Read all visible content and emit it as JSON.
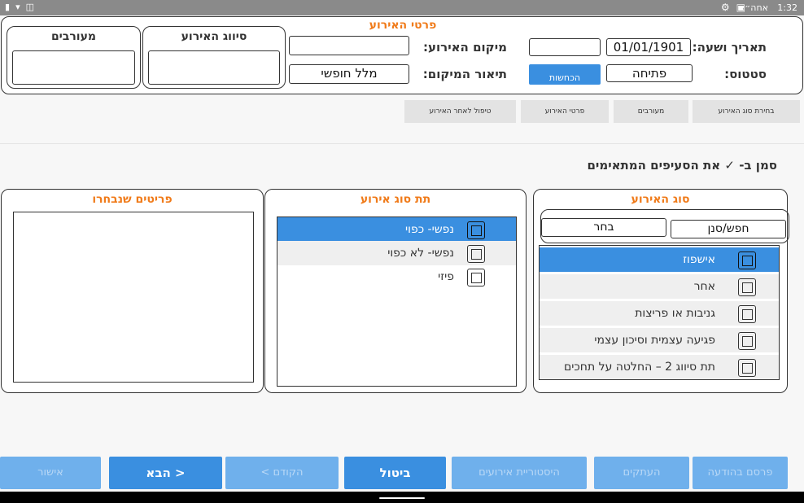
{
  "status_bar": {
    "time": "1:32",
    "carrier": "אחה״צ",
    "icons": [
      "gear-icon",
      "image-icon",
      "battery-icon",
      "wifi-icon",
      "vibrate-icon"
    ]
  },
  "header": {
    "title": "פרטי האירוע",
    "date_label": "תאריך ושעה:",
    "date_value": "01/01/1901",
    "time_value": "",
    "status_label": "סטטוס:",
    "status_value": "פתיחה",
    "status_button_label": "הכחשות",
    "location_label": "מיקום האירוע:",
    "location_value": "",
    "location_desc_label": "תיאור המיקום:",
    "location_desc_value": "מלל חופשי",
    "classification_title": "סיווג האירוע",
    "involved_title": "מעורבים"
  },
  "tabs": [
    {
      "label": "בחירת סוג האירוע"
    },
    {
      "label": "מעורבים"
    },
    {
      "label": "פרטי האירוע"
    },
    {
      "label": "טיפול לאחר האירוע"
    }
  ],
  "instruction": "סמן ב- ✓ את הסעיפים המתאימים",
  "event_type_panel": {
    "title": "סוג האירוע",
    "search_value": "חפש/סנן",
    "choose_value": "בחר",
    "items": [
      {
        "label": "אישפוז",
        "selected": true
      },
      {
        "label": "אחר",
        "selected": false
      },
      {
        "label": "גניבות או פריצות",
        "selected": false
      },
      {
        "label": "פגיעה עצמית וסיכון עצמי",
        "selected": false
      },
      {
        "label": "תת סיווג 2 – החלטה על תחכים",
        "selected": false
      }
    ]
  },
  "sub_type_panel": {
    "title": "תת סוג אירוע",
    "items": [
      {
        "label": "נפשי- כפוי",
        "selected": true
      },
      {
        "label": "נפשי- לא כפוי",
        "selected": false
      },
      {
        "label": "פיזי",
        "selected": false
      }
    ]
  },
  "selected_panel": {
    "title": "פריטים שנבחרו"
  },
  "footer": {
    "buttons": [
      {
        "label": "פרסם בהודעה",
        "disabled": true
      },
      {
        "label": "העתקים",
        "disabled": true
      },
      {
        "label": "היסטוריית אירועים",
        "disabled": true
      },
      {
        "label": "ביטול",
        "disabled": false
      },
      {
        "label": "< הקודם",
        "disabled": true
      },
      {
        "label": "הבא >",
        "disabled": false
      },
      {
        "label": "אישור",
        "disabled": true
      }
    ]
  },
  "colors": {
    "accent_orange": "#f07b1a",
    "primary_blue": "#3a8fe0",
    "disabled_blue": "#6fb0ec"
  }
}
